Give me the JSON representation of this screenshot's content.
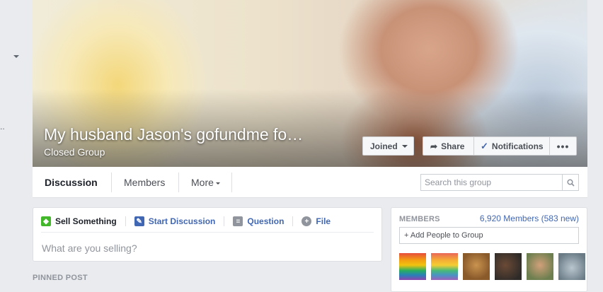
{
  "group": {
    "title": "My husband Jason's gofundme fo…",
    "privacy": "Closed Group"
  },
  "actions": {
    "joined": "Joined",
    "share": "Share",
    "notifications": "Notifications",
    "more": "•••"
  },
  "tabs": {
    "discussion": "Discussion",
    "members": "Members",
    "more": "More"
  },
  "search": {
    "placeholder": "Search this group"
  },
  "composer": {
    "sell": "Sell Something",
    "discussion": "Start Discussion",
    "question": "Question",
    "file": "File",
    "prompt": "What are you selling?"
  },
  "pinned_label": "PINNED POST",
  "members": {
    "label": "MEMBERS",
    "count": "6,920 Members",
    "new": "(583 new)",
    "add": "+ Add People to Group"
  },
  "colors": {
    "accent": "#4267b2",
    "sell": "#42b72a",
    "background": "#e9ebee"
  },
  "icons": [
    "chevron-down-icon",
    "share-arrow-icon",
    "check-icon",
    "more-dots-icon",
    "search-icon",
    "tag-icon",
    "pencil-icon",
    "question-icon",
    "file-icon"
  ]
}
